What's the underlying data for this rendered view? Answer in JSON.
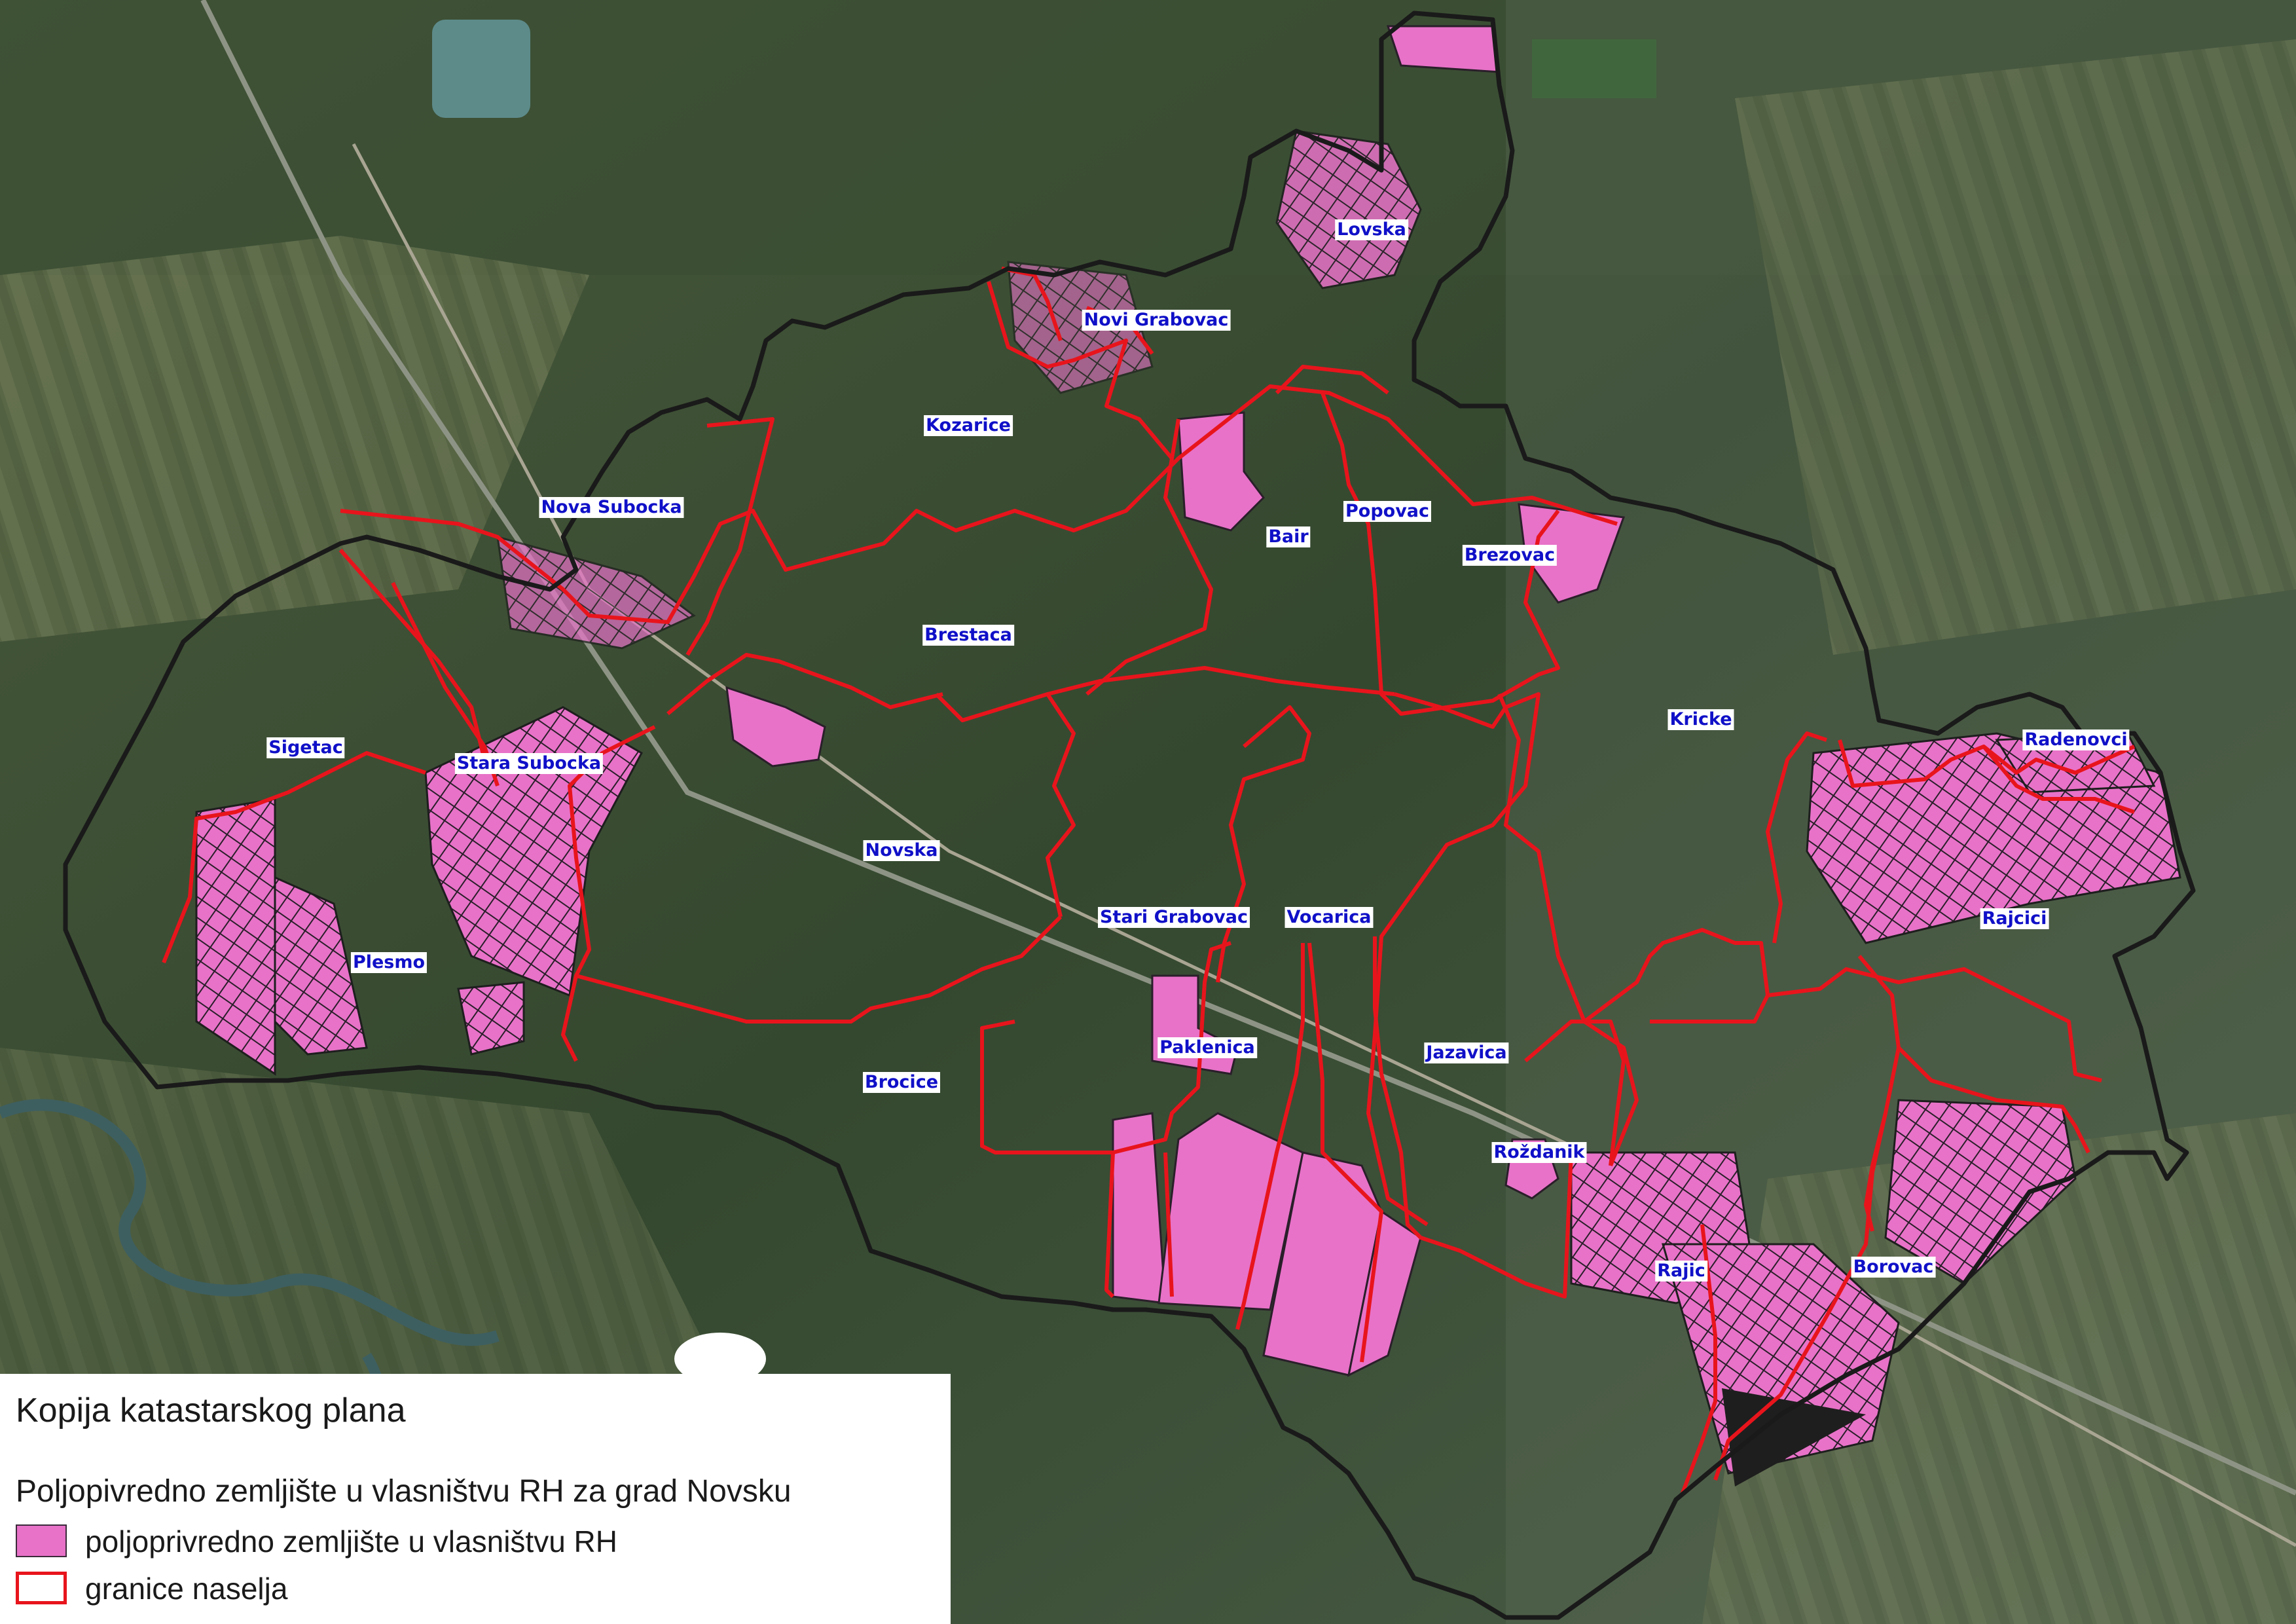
{
  "legend": {
    "title": "Kopija katastarskog plana",
    "subtitle": "Poljopivredno zemljište u vlasništvu RH za grad Novsku",
    "items": [
      {
        "label": "poljoprivredno zemljište u vlasništvu RH",
        "color": "#e872c8",
        "icon": "pink-fill-swatch"
      },
      {
        "label": "granice naselja",
        "color": "#e8141c",
        "icon": "red-outline-swatch"
      }
    ]
  },
  "colors": {
    "city_boundary": "#1a1a1a",
    "settlement_boundary": "#e8141c",
    "state_land": "#e872c8",
    "label_text": "#1010c8",
    "label_background": "#ffffff"
  },
  "places": [
    {
      "name": "Lovska"
    },
    {
      "name": "Novi Grabovac"
    },
    {
      "name": "Kozarice"
    },
    {
      "name": "Nova Subocka"
    },
    {
      "name": "Bair"
    },
    {
      "name": "Popovac"
    },
    {
      "name": "Brezovac"
    },
    {
      "name": "Brestaca"
    },
    {
      "name": "Kricke"
    },
    {
      "name": "Sigetac"
    },
    {
      "name": "Stara Subocka"
    },
    {
      "name": "Radenovci"
    },
    {
      "name": "Novska"
    },
    {
      "name": "Rajcici"
    },
    {
      "name": "Stari Grabovac"
    },
    {
      "name": "Vocarica"
    },
    {
      "name": "Plesmo"
    },
    {
      "name": "Paklenica"
    },
    {
      "name": "Jazavica"
    },
    {
      "name": "Brocice"
    },
    {
      "name": "Roždanik"
    },
    {
      "name": "Rajic"
    },
    {
      "name": "Borovac"
    }
  ]
}
